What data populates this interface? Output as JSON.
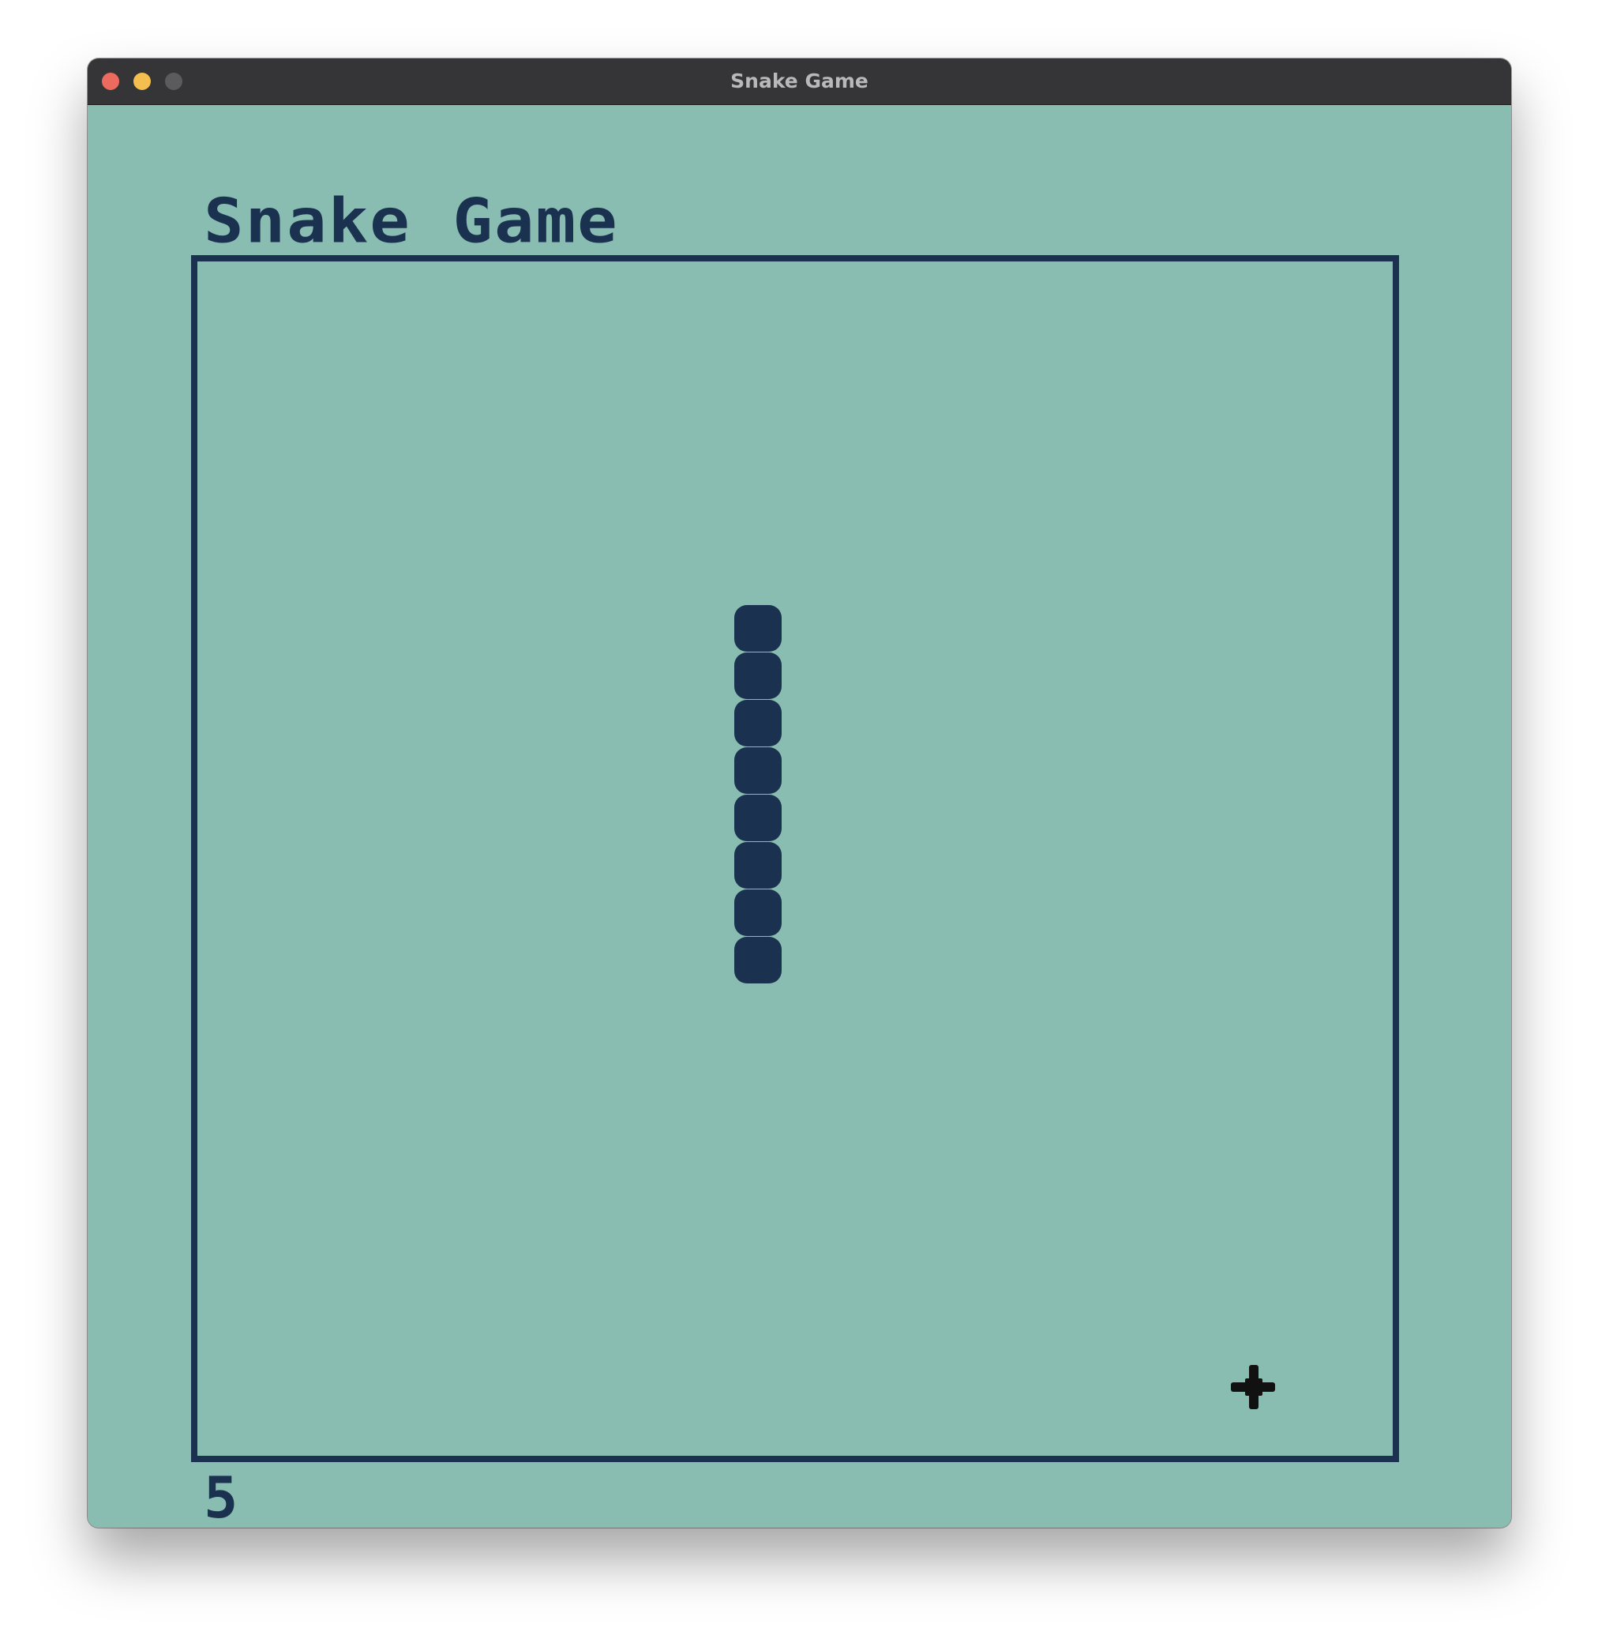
{
  "window": {
    "title": "Snake Game"
  },
  "game": {
    "title": "Snake Game",
    "score": "5",
    "colors": {
      "background": "#8abdb1",
      "ink": "#1a3150",
      "food": "#111111"
    },
    "snake": {
      "direction": "vertical",
      "segments": 8
    },
    "food_icon": "food-plus-icon"
  }
}
